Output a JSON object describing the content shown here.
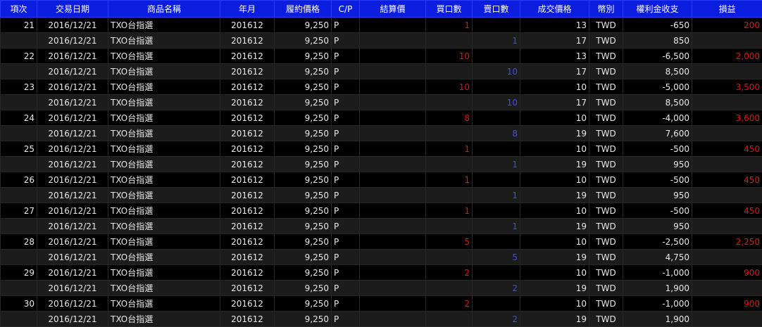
{
  "headers": [
    "項次",
    "交易日期",
    "商品名稱",
    "年月",
    "履約價格",
    "C/P",
    "結算價",
    "買口數",
    "賣口數",
    "成交價格",
    "幣別",
    "權利金收支",
    "損益"
  ],
  "rows": [
    {
      "no": "21",
      "date": "2016/12/21",
      "product": "TXO台指選",
      "ym": "201612",
      "strike": "9,250",
      "cp": "P",
      "settle": "",
      "buy": "1",
      "sell": "",
      "price": "13",
      "cur": "TWD",
      "premium": "-650",
      "pnl": "200"
    },
    {
      "no": "",
      "date": "2016/12/21",
      "product": "TXO台指選",
      "ym": "201612",
      "strike": "9,250",
      "cp": "P",
      "settle": "",
      "buy": "",
      "sell": "1",
      "price": "17",
      "cur": "TWD",
      "premium": "850",
      "pnl": ""
    },
    {
      "no": "22",
      "date": "2016/12/21",
      "product": "TXO台指選",
      "ym": "201612",
      "strike": "9,250",
      "cp": "P",
      "settle": "",
      "buy": "10",
      "sell": "",
      "price": "13",
      "cur": "TWD",
      "premium": "-6,500",
      "pnl": "2,000"
    },
    {
      "no": "",
      "date": "2016/12/21",
      "product": "TXO台指選",
      "ym": "201612",
      "strike": "9,250",
      "cp": "P",
      "settle": "",
      "buy": "",
      "sell": "10",
      "price": "17",
      "cur": "TWD",
      "premium": "8,500",
      "pnl": ""
    },
    {
      "no": "23",
      "date": "2016/12/21",
      "product": "TXO台指選",
      "ym": "201612",
      "strike": "9,250",
      "cp": "P",
      "settle": "",
      "buy": "10",
      "sell": "",
      "price": "10",
      "cur": "TWD",
      "premium": "-5,000",
      "pnl": "3,500"
    },
    {
      "no": "",
      "date": "2016/12/21",
      "product": "TXO台指選",
      "ym": "201612",
      "strike": "9,250",
      "cp": "P",
      "settle": "",
      "buy": "",
      "sell": "10",
      "price": "17",
      "cur": "TWD",
      "premium": "8,500",
      "pnl": ""
    },
    {
      "no": "24",
      "date": "2016/12/21",
      "product": "TXO台指選",
      "ym": "201612",
      "strike": "9,250",
      "cp": "P",
      "settle": "",
      "buy": "8",
      "sell": "",
      "price": "10",
      "cur": "TWD",
      "premium": "-4,000",
      "pnl": "3,600"
    },
    {
      "no": "",
      "date": "2016/12/21",
      "product": "TXO台指選",
      "ym": "201612",
      "strike": "9,250",
      "cp": "P",
      "settle": "",
      "buy": "",
      "sell": "8",
      "price": "19",
      "cur": "TWD",
      "premium": "7,600",
      "pnl": ""
    },
    {
      "no": "25",
      "date": "2016/12/21",
      "product": "TXO台指選",
      "ym": "201612",
      "strike": "9,250",
      "cp": "P",
      "settle": "",
      "buy": "1",
      "sell": "",
      "price": "10",
      "cur": "TWD",
      "premium": "-500",
      "pnl": "450"
    },
    {
      "no": "",
      "date": "2016/12/21",
      "product": "TXO台指選",
      "ym": "201612",
      "strike": "9,250",
      "cp": "P",
      "settle": "",
      "buy": "",
      "sell": "1",
      "price": "19",
      "cur": "TWD",
      "premium": "950",
      "pnl": ""
    },
    {
      "no": "26",
      "date": "2016/12/21",
      "product": "TXO台指選",
      "ym": "201612",
      "strike": "9,250",
      "cp": "P",
      "settle": "",
      "buy": "1",
      "sell": "",
      "price": "10",
      "cur": "TWD",
      "premium": "-500",
      "pnl": "450"
    },
    {
      "no": "",
      "date": "2016/12/21",
      "product": "TXO台指選",
      "ym": "201612",
      "strike": "9,250",
      "cp": "P",
      "settle": "",
      "buy": "",
      "sell": "1",
      "price": "19",
      "cur": "TWD",
      "premium": "950",
      "pnl": ""
    },
    {
      "no": "27",
      "date": "2016/12/21",
      "product": "TXO台指選",
      "ym": "201612",
      "strike": "9,250",
      "cp": "P",
      "settle": "",
      "buy": "1",
      "sell": "",
      "price": "10",
      "cur": "TWD",
      "premium": "-500",
      "pnl": "450"
    },
    {
      "no": "",
      "date": "2016/12/21",
      "product": "TXO台指選",
      "ym": "201612",
      "strike": "9,250",
      "cp": "P",
      "settle": "",
      "buy": "",
      "sell": "1",
      "price": "19",
      "cur": "TWD",
      "premium": "950",
      "pnl": ""
    },
    {
      "no": "28",
      "date": "2016/12/21",
      "product": "TXO台指選",
      "ym": "201612",
      "strike": "9,250",
      "cp": "P",
      "settle": "",
      "buy": "5",
      "sell": "",
      "price": "10",
      "cur": "TWD",
      "premium": "-2,500",
      "pnl": "2,250"
    },
    {
      "no": "",
      "date": "2016/12/21",
      "product": "TXO台指選",
      "ym": "201612",
      "strike": "9,250",
      "cp": "P",
      "settle": "",
      "buy": "",
      "sell": "5",
      "price": "19",
      "cur": "TWD",
      "premium": "4,750",
      "pnl": ""
    },
    {
      "no": "29",
      "date": "2016/12/21",
      "product": "TXO台指選",
      "ym": "201612",
      "strike": "9,250",
      "cp": "P",
      "settle": "",
      "buy": "2",
      "sell": "",
      "price": "10",
      "cur": "TWD",
      "premium": "-1,000",
      "pnl": "900"
    },
    {
      "no": "",
      "date": "2016/12/21",
      "product": "TXO台指選",
      "ym": "201612",
      "strike": "9,250",
      "cp": "P",
      "settle": "",
      "buy": "",
      "sell": "2",
      "price": "19",
      "cur": "TWD",
      "premium": "1,900",
      "pnl": ""
    },
    {
      "no": "30",
      "date": "2016/12/21",
      "product": "TXO台指選",
      "ym": "201612",
      "strike": "9,250",
      "cp": "P",
      "settle": "",
      "buy": "2",
      "sell": "",
      "price": "10",
      "cur": "TWD",
      "premium": "-1,000",
      "pnl": "900"
    },
    {
      "no": "",
      "date": "2016/12/21",
      "product": "TXO台指選",
      "ym": "201612",
      "strike": "9,250",
      "cp": "P",
      "settle": "",
      "buy": "",
      "sell": "2",
      "price": "19",
      "cur": "TWD",
      "premium": "1,900",
      "pnl": ""
    }
  ],
  "colors": {
    "header_bg": "#0b1ee0",
    "buy": "#e81010",
    "sell": "#4848f0",
    "pnl": "#e81010",
    "row_dark": "#000000",
    "row_light": "#1c1c1c"
  }
}
